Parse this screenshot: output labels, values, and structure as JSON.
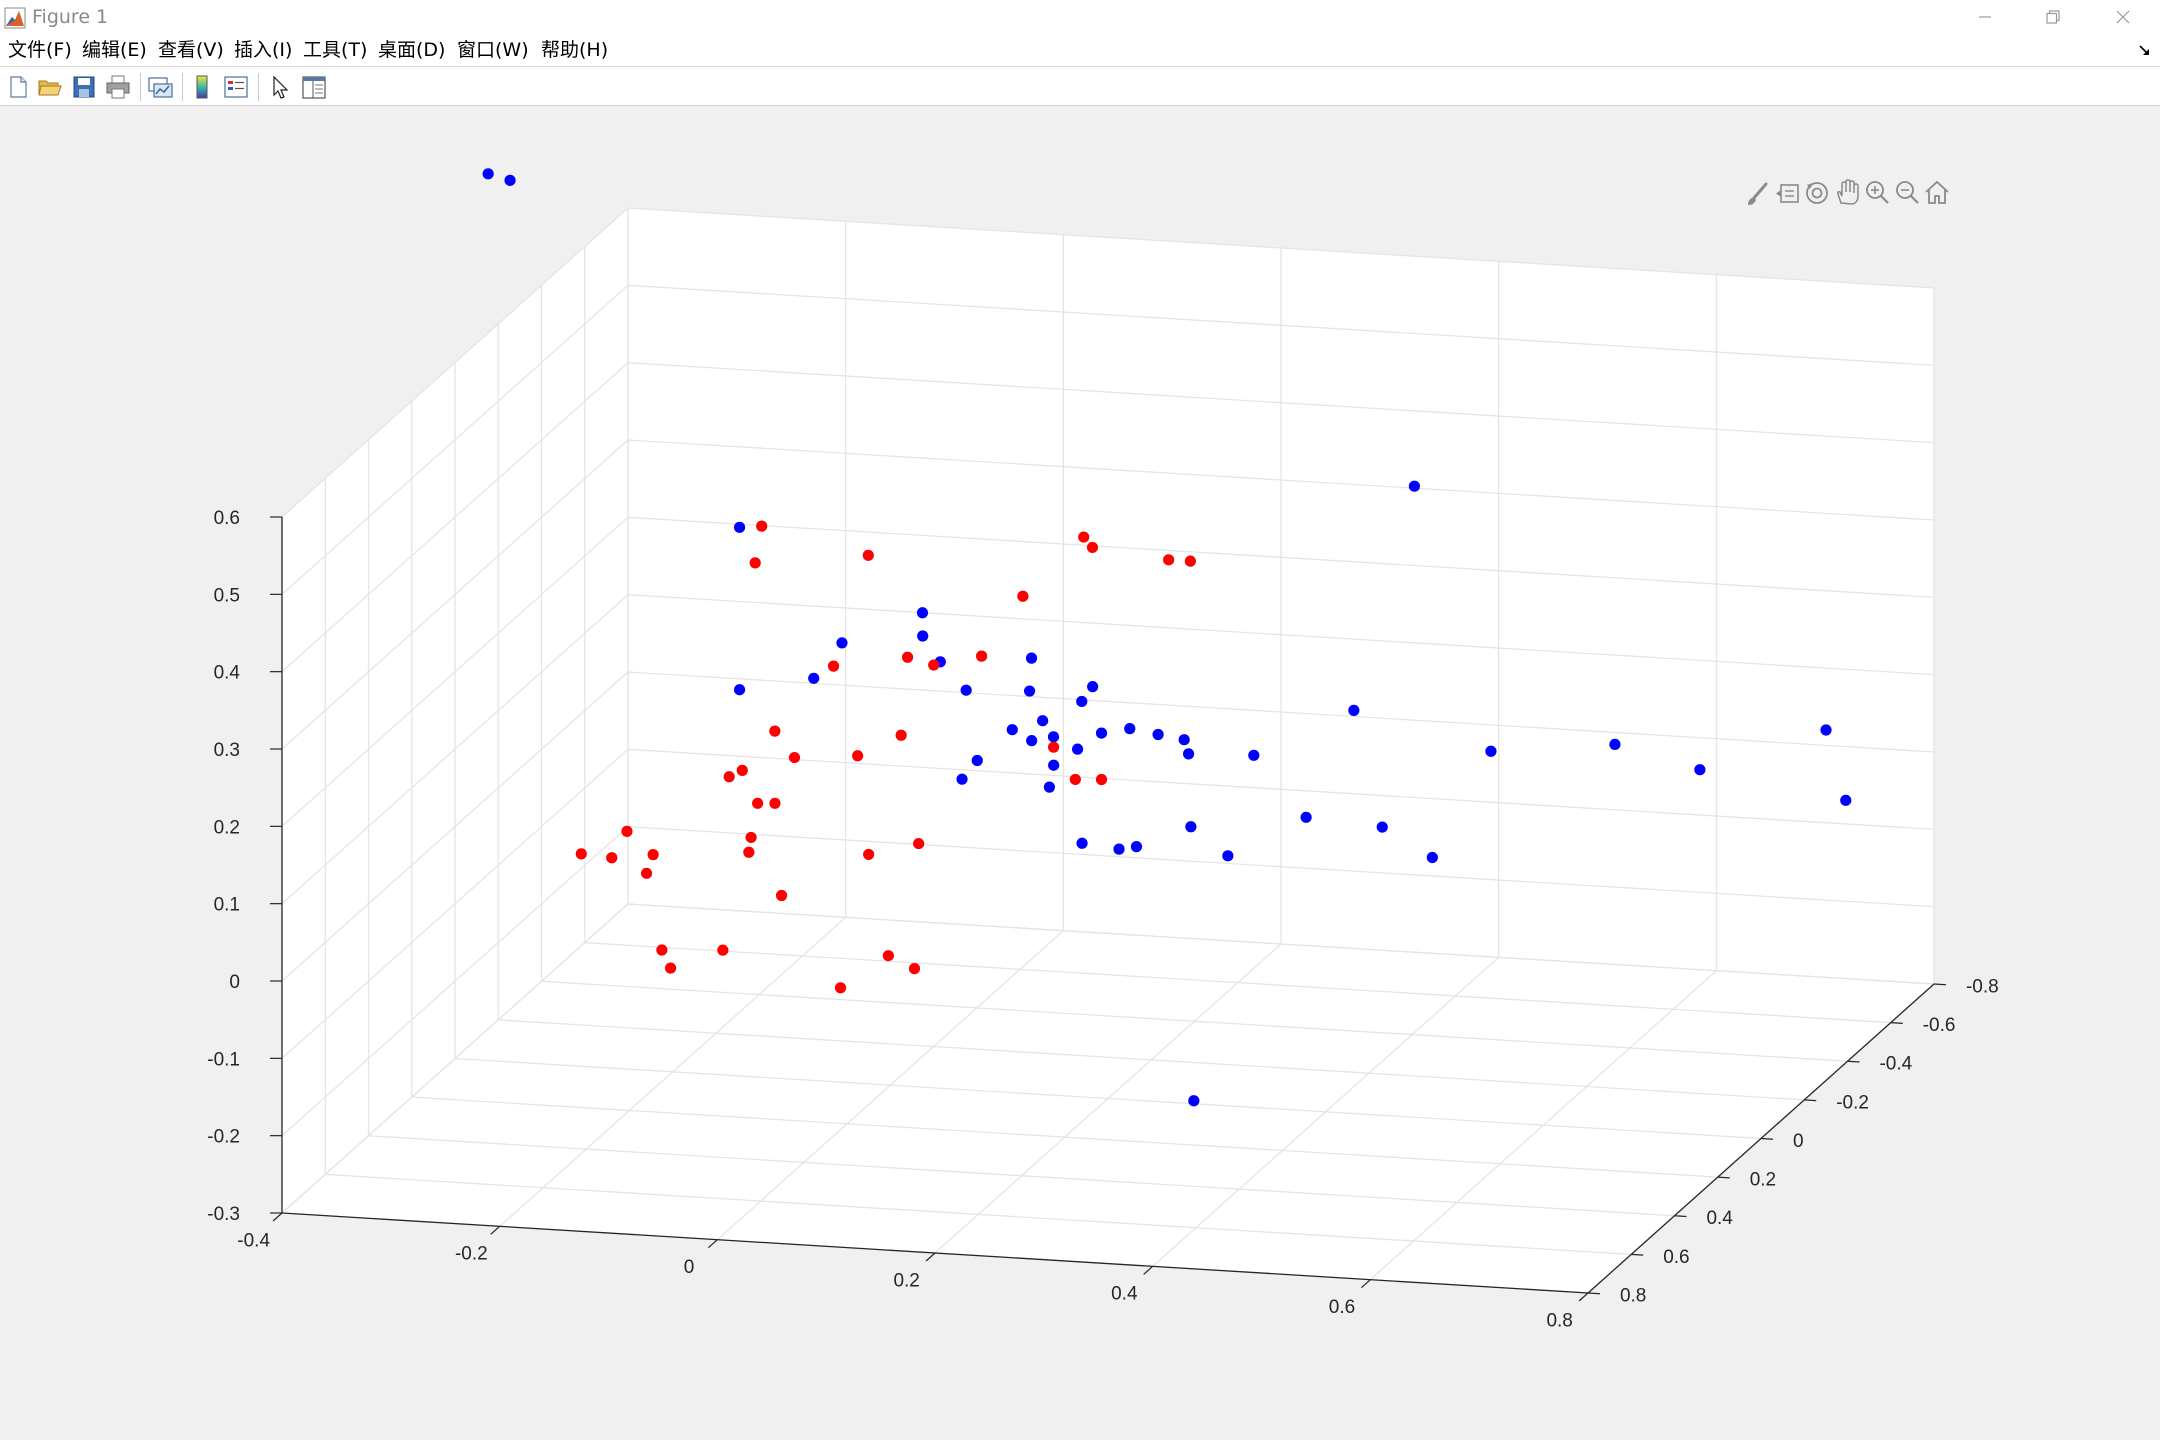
{
  "window": {
    "title": "Figure 1"
  },
  "menu": {
    "items": [
      {
        "label": "文件(F)"
      },
      {
        "label": "编辑(E)"
      },
      {
        "label": "查看(V)"
      },
      {
        "label": "插入(I)"
      },
      {
        "label": "工具(T)"
      },
      {
        "label": "桌面(D)"
      },
      {
        "label": "窗口(W)"
      },
      {
        "label": "帮助(H)"
      }
    ]
  },
  "toolbar": {
    "buttons": [
      {
        "name": "new-figure-icon"
      },
      {
        "name": "open-file-icon"
      },
      {
        "name": "save-icon"
      },
      {
        "name": "print-icon"
      },
      {
        "name": "link-plot-icon"
      },
      {
        "name": "insert-colorbar-icon"
      },
      {
        "name": "insert-legend-icon"
      },
      {
        "name": "edit-plot-pointer-icon"
      },
      {
        "name": "property-inspector-icon"
      }
    ]
  },
  "axes_toolbar": {
    "tools": [
      {
        "name": "brush-icon"
      },
      {
        "name": "datatip-icon"
      },
      {
        "name": "rotate-3d-icon"
      },
      {
        "name": "pan-hand-icon"
      },
      {
        "name": "zoom-in-icon"
      },
      {
        "name": "zoom-out-icon"
      },
      {
        "name": "home-restore-view-icon"
      }
    ]
  },
  "chart_data": {
    "type": "scatter",
    "view": "3d",
    "title": "",
    "xlabel": "",
    "ylabel": "",
    "zlabel": "",
    "grid": true,
    "xlim": [
      -0.4,
      0.8
    ],
    "ylim": [
      -0.8,
      0.8
    ],
    "zlim": [
      -0.3,
      0.6
    ],
    "x_ticks": [
      "-0.4",
      "-0.2",
      "0",
      "0.2",
      "0.4",
      "0.6",
      "0.8"
    ],
    "y_ticks": [
      "-0.8",
      "-0.6",
      "-0.4",
      "-0.2",
      "0",
      "0.2",
      "0.4",
      "0.6",
      "0.8"
    ],
    "z_ticks": [
      "-0.3",
      "-0.2",
      "-0.1",
      "0",
      "0.1",
      "0.2",
      "0.3",
      "0.4",
      "0.5",
      "0.6"
    ],
    "series": [
      {
        "color": "#0000ff",
        "points": [
          [
            -0.3,
            0.35,
            0.94
          ],
          [
            -0.26,
            0.45,
            0.96
          ],
          [
            -0.22,
            -0.41,
            0.3
          ],
          [
            -0.22,
            -0.41,
            0.09
          ],
          [
            -0.13,
            -0.3,
            0.14
          ],
          [
            -0.11,
            -0.33,
            0.18
          ],
          [
            -0.04,
            -0.35,
            0.22
          ],
          [
            -0.01,
            -0.2,
            0.23
          ],
          [
            0.02,
            -0.25,
            0.15
          ],
          [
            0.03,
            -0.08,
            0.23
          ],
          [
            0.05,
            -0.08,
            0.08
          ],
          [
            0.06,
            -0.1,
            0.1
          ],
          [
            0.09,
            -0.2,
            0.21
          ],
          [
            0.11,
            -0.1,
            0.13
          ],
          [
            0.12,
            -0.04,
            0.21
          ],
          [
            0.12,
            0.04,
            0.18
          ],
          [
            0.13,
            -0.05,
            0.17
          ],
          [
            0.14,
            -0.05,
            0.15
          ],
          [
            0.16,
            -0.08,
            0.19
          ],
          [
            0.16,
            0.05,
            0.14
          ],
          [
            0.17,
            -0.08,
            0.21
          ],
          [
            0.17,
            0.12,
            0.13
          ],
          [
            0.18,
            0.04,
            0.16
          ],
          [
            0.2,
            0.03,
            0.18
          ],
          [
            0.2,
            0.12,
            0.06
          ],
          [
            0.22,
            0.0,
            0.18
          ],
          [
            0.23,
            0.1,
            0.05
          ],
          [
            0.25,
            0.02,
            0.18
          ],
          [
            0.25,
            0.12,
            0.06
          ],
          [
            0.27,
            0.0,
            0.17
          ],
          [
            0.28,
            0.03,
            0.16
          ],
          [
            0.3,
            0.12,
            0.09
          ],
          [
            0.33,
            0.1,
            0.05
          ],
          [
            0.33,
            -0.02,
            0.15
          ],
          [
            0.39,
            0.04,
            0.09
          ],
          [
            0.41,
            -0.36,
            0.42
          ],
          [
            0.41,
            -0.08,
            0.2
          ],
          [
            0.41,
            0.66,
            -0.12
          ],
          [
            0.45,
            -0.01,
            0.07
          ],
          [
            0.5,
            0.01,
            0.04
          ],
          [
            0.53,
            -0.11,
            0.15
          ],
          [
            0.63,
            -0.18,
            0.15
          ],
          [
            0.72,
            -0.12,
            0.14
          ],
          [
            0.82,
            -0.2,
            0.18
          ],
          [
            0.86,
            -0.09,
            0.12
          ]
        ]
      },
      {
        "color": "#ff0000",
        "points": [
          [
            -0.28,
            0.02,
            -0.02
          ],
          [
            -0.25,
            0.03,
            -0.02
          ],
          [
            -0.24,
            0.01,
            0.01
          ],
          [
            -0.22,
            0.02,
            -0.04
          ],
          [
            -0.21,
            0.04,
            -0.01
          ],
          [
            -0.2,
            0.05,
            -0.13
          ],
          [
            -0.19,
            0.06,
            -0.15
          ],
          [
            -0.16,
            -0.06,
            0.07
          ],
          [
            -0.15,
            -0.16,
            0.37
          ],
          [
            -0.15,
            -0.13,
            0.33
          ],
          [
            -0.14,
            -0.02,
            0.09
          ],
          [
            -0.14,
            0.07,
            -0.12
          ],
          [
            -0.13,
            0.0,
            -0.01
          ],
          [
            -0.12,
            0.04,
            0.02
          ],
          [
            -0.12,
            -0.07,
            0.13
          ],
          [
            -0.11,
            -0.02,
            0.05
          ],
          [
            -0.11,
            0.06,
            0.07
          ],
          [
            -0.1,
            -0.06,
            0.1
          ],
          [
            -0.09,
            0.05,
            -0.05
          ],
          [
            -0.08,
            -0.14,
            0.2
          ],
          [
            -0.06,
            -0.2,
            0.33
          ],
          [
            -0.04,
            -0.05,
            0.11
          ],
          [
            -0.01,
            -0.13,
            0.22
          ],
          [
            -0.01,
            0.05,
            0.01
          ],
          [
            -0.01,
            0.18,
            -0.13
          ],
          [
            -0.0,
            -0.05,
            0.14
          ],
          [
            0.02,
            -0.1,
            0.22
          ],
          [
            0.03,
            0.02,
            0.02
          ],
          [
            0.03,
            0.16,
            -0.09
          ],
          [
            0.05,
            0.14,
            -0.11
          ],
          [
            0.06,
            -0.12,
            0.23
          ],
          [
            0.09,
            -0.16,
            0.3
          ],
          [
            0.13,
            -0.24,
            0.36
          ],
          [
            0.14,
            -0.23,
            0.35
          ],
          [
            0.15,
            0.0,
            0.15
          ],
          [
            0.17,
            0.0,
            0.11
          ],
          [
            0.2,
            0.03,
            0.12
          ],
          [
            0.21,
            -0.23,
            0.34
          ],
          [
            0.23,
            -0.23,
            0.34
          ]
        ]
      }
    ]
  }
}
